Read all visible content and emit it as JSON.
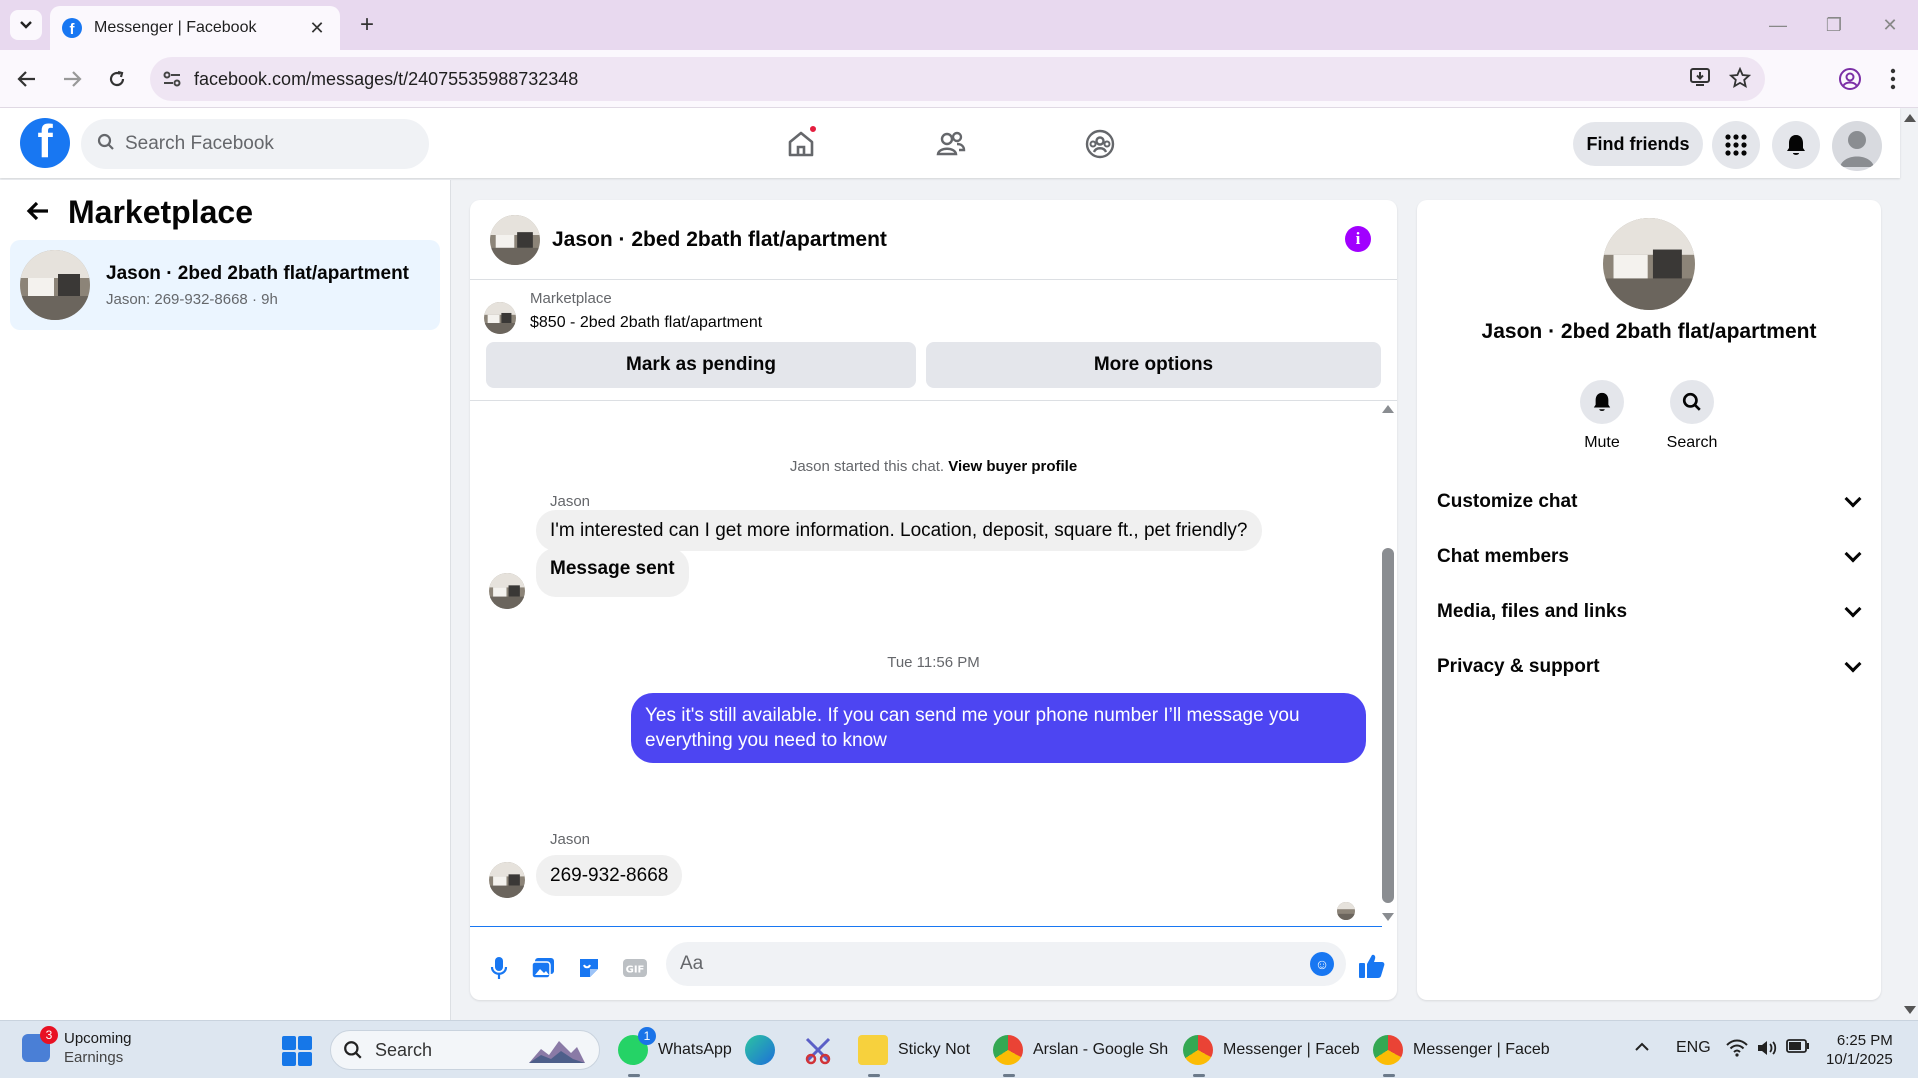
{
  "browser": {
    "tab_title": "Messenger | Facebook",
    "url": "facebook.com/messages/t/24075535988732348"
  },
  "fb_header": {
    "search_placeholder": "Search Facebook",
    "find_friends_label": "Find friends"
  },
  "left_panel": {
    "title": "Marketplace",
    "conversations": [
      {
        "name": "Jason · 2bed 2bath flat/apartment",
        "preview": "Jason: 269-932-8668 · 9h"
      }
    ]
  },
  "chat": {
    "title": "Jason · 2bed 2bath flat/apartment",
    "listing": {
      "source": "Marketplace",
      "title": "$850 - 2bed 2bath flat/apartment"
    },
    "actions": {
      "mark_pending": "Mark as pending",
      "more_options": "More options"
    },
    "system_text": "Jason started this chat.",
    "system_link": "View buyer profile",
    "messages": [
      {
        "sender": "Jason",
        "text": "I'm interested can I get more information. Location, deposit, square ft., pet friendly?"
      },
      {
        "sender": "",
        "text": "Message sent"
      },
      {
        "timestamp": "Tue 11:56 PM"
      },
      {
        "sender": "me",
        "text": "Yes it's still available. If you can send me your phone number I’ll message you everything you need to know"
      },
      {
        "sender": "Jason",
        "text": "269-932-8668"
      }
    ],
    "composer_placeholder": "Aa"
  },
  "right_panel": {
    "name": "Jason · 2bed 2bath flat/apartment",
    "mute_label": "Mute",
    "search_label": "Search",
    "sections": [
      "Customize chat",
      "Chat members",
      "Media, files and links",
      "Privacy & support"
    ]
  },
  "taskbar": {
    "widget_title": "Upcoming",
    "widget_sub": "Earnings",
    "widget_badge": "3",
    "search_label": "Search",
    "apps": [
      {
        "label": "WhatsApp",
        "badge": "1"
      },
      {
        "label": "Sticky Note"
      },
      {
        "label": "Arslan - Google Sh"
      },
      {
        "label": "Messenger | Faceb"
      },
      {
        "label": "Messenger | Faceb"
      }
    ],
    "language": "ENG",
    "time": "6:25 PM",
    "date": "10/1/2025"
  },
  "colors": {
    "brand_blue": "#1877f2",
    "outgoing_bubble": "#4d45f2",
    "info_purple": "#a100ff"
  }
}
